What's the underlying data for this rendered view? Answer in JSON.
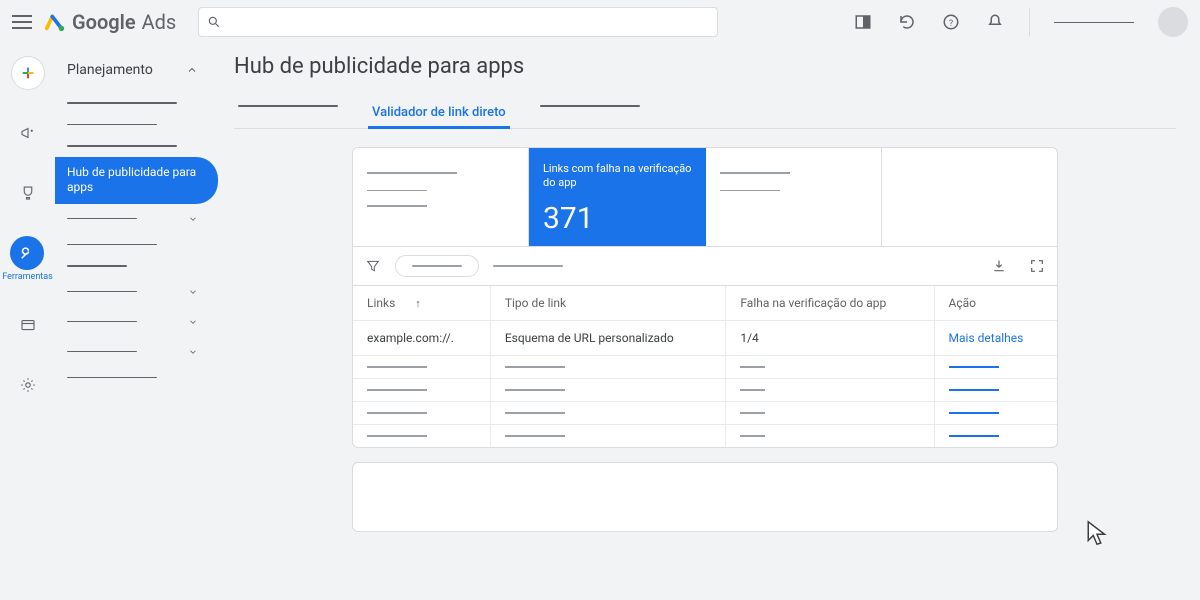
{
  "header": {
    "logo_product": "Google",
    "logo_sub": "Ads"
  },
  "rail": {
    "ferramentas": "Ferramentas"
  },
  "secnav": {
    "heading": "Planejamento",
    "active_item": "Hub de publicidade para apps"
  },
  "page": {
    "title": "Hub de publicidade para apps"
  },
  "tabs": {
    "active": "Validador de link direto"
  },
  "summary": {
    "blue_tile_label": "Links com falha na verificação do app",
    "blue_tile_value": "371"
  },
  "table": {
    "headers": {
      "links": "Links",
      "tipo": "Tipo de link",
      "falha": "Falha na verificação do app",
      "acao": "Ação"
    },
    "rows": [
      {
        "link": "example.com://.",
        "tipo": "Esquema de URL personalizado",
        "falha": "1/4",
        "acao": "Mais detalhes"
      }
    ]
  }
}
